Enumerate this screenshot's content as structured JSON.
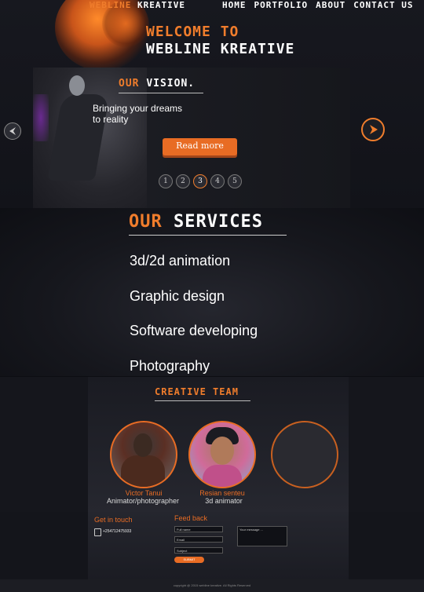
{
  "header": {
    "brand_first": "WEBLINE",
    "brand_second": "KREATIVE",
    "nav": [
      "HOME",
      "PORTFOLIO",
      "ABOUT",
      "CONTACT US"
    ]
  },
  "hero": {
    "welcome_line1": "WELCOME TO",
    "welcome_line2": "WEBLINE KREATIVE"
  },
  "slider": {
    "title_accent": "OUR",
    "title_main": "VISION.",
    "text_line1": "Bringing your dreams",
    "text_line2": "to reality",
    "button": "Read more",
    "pages": [
      "1",
      "2",
      "3",
      "4",
      "5"
    ],
    "active_page": "3"
  },
  "services": {
    "title_accent": "OUR",
    "title_main": "SERVICES",
    "items": [
      "3d/2d animation",
      "Graphic  design",
      "Software developing",
      "Photography"
    ]
  },
  "team": {
    "title": "CREATIVE TEAM",
    "members": [
      {
        "name": "Victor Tanui",
        "role": "Animator/photographer"
      },
      {
        "name": "Resian senteu",
        "role": "3d animator"
      }
    ]
  },
  "contact": {
    "title": "Get in touch",
    "phone": "+254712475933"
  },
  "feedback": {
    "title": "Feed back",
    "fullname_placeholder": "Full name",
    "email_placeholder": "Email",
    "subject_placeholder": "Subject",
    "message_placeholder": "Your message ...",
    "submit": "SUBMIT"
  },
  "footer": {
    "copyright": "copyright @ 2015 webline kreative. All Rights Reserved"
  },
  "colors": {
    "accent": "#f07d2c",
    "background": "#0c0d12"
  }
}
